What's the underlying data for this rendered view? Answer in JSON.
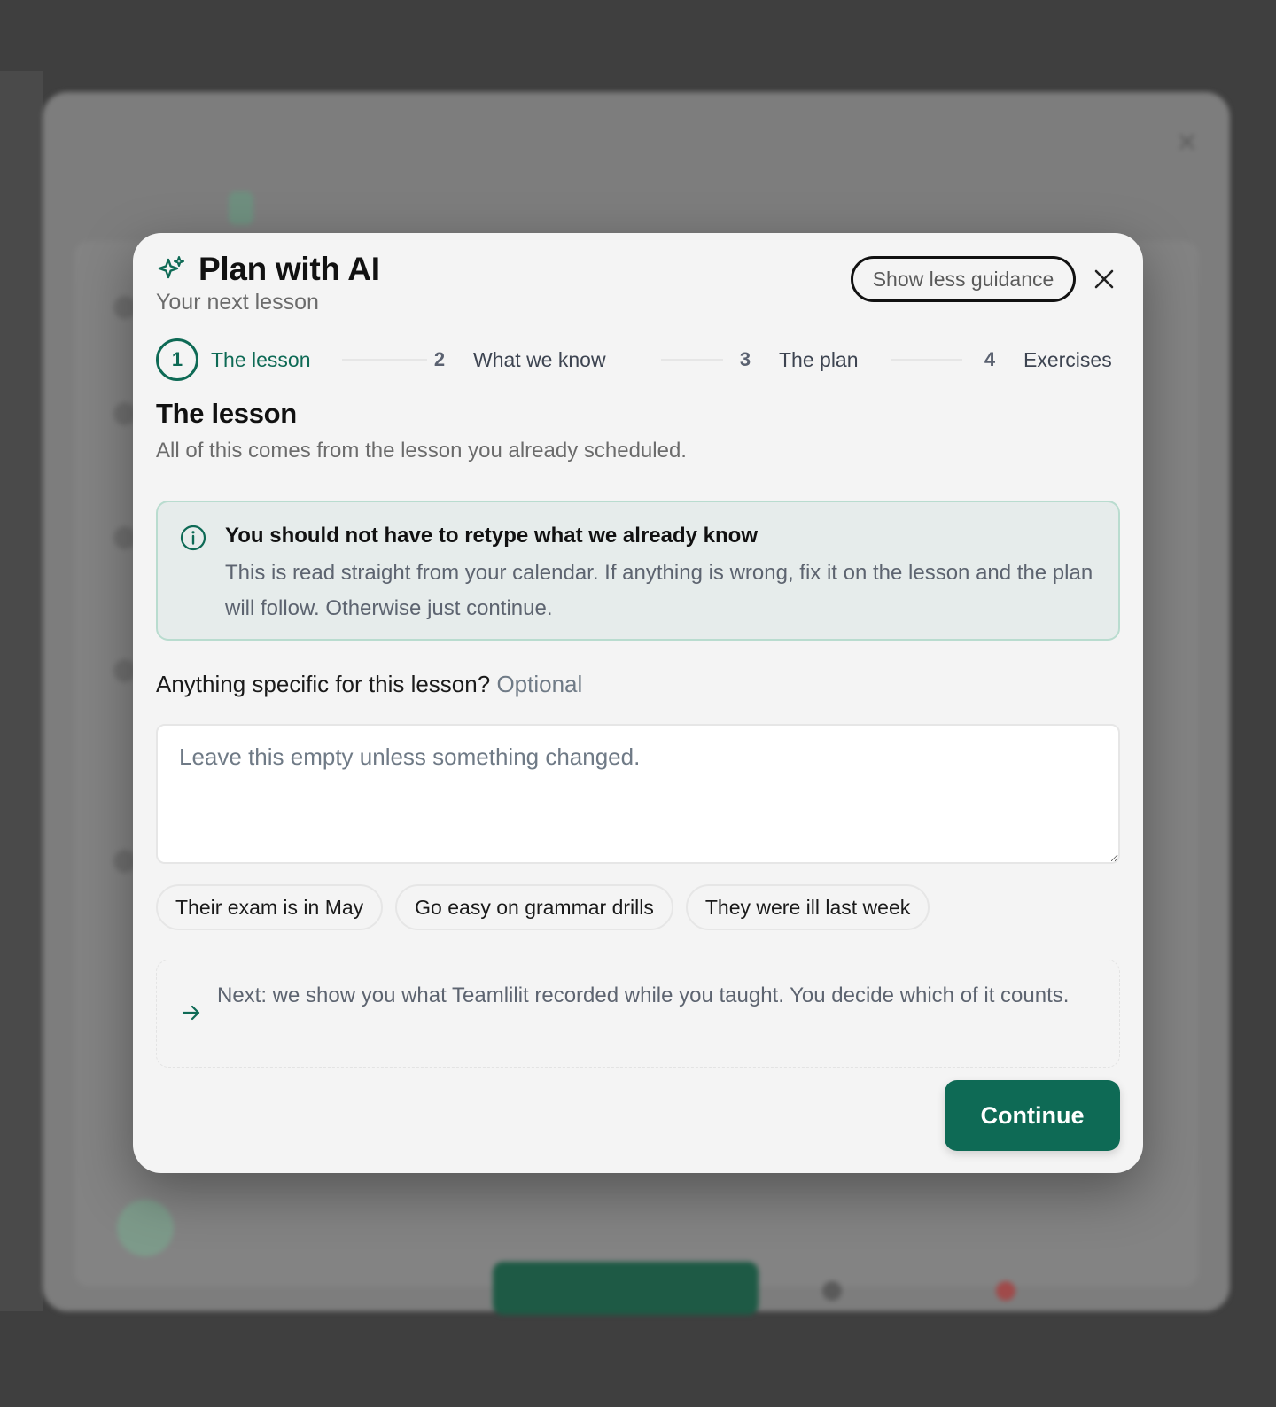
{
  "modal": {
    "title": "Plan with AI",
    "subtitle": "Your next lesson",
    "guidance_label": "Show less guidance"
  },
  "stepper": {
    "steps": [
      {
        "number": "1",
        "label": "The lesson"
      },
      {
        "number": "2",
        "label": "What we know"
      },
      {
        "number": "3",
        "label": "The plan"
      },
      {
        "number": "4",
        "label": "Exercises"
      }
    ]
  },
  "section": {
    "title": "The lesson",
    "description": "All of this comes from the lesson you already scheduled."
  },
  "info": {
    "title": "You should not have to retype what we already know",
    "body": "This is read straight from your calendar. If anything is wrong, fix it on the lesson and the plan will follow. Otherwise just continue."
  },
  "notes_field": {
    "label": "Anything specific for this lesson?",
    "optional": "Optional",
    "placeholder": "Leave this empty unless something changed.",
    "value": ""
  },
  "chips": [
    "Their exam is in May",
    "Go easy on grammar drills",
    "They were ill last week"
  ],
  "next_hint": "Next: we show you what Teamlilit recorded while you taught. You decide which of it counts.",
  "continue_label": "Continue",
  "colors": {
    "primary": "#0e6a55",
    "info_background": "#e6eceb",
    "info_border": "#b9dccf",
    "modal_background": "#f4f4f4"
  },
  "icons": {
    "title": "sparkle-icon",
    "close": "close-icon",
    "info": "info-icon",
    "next": "arrow-right-icon"
  }
}
